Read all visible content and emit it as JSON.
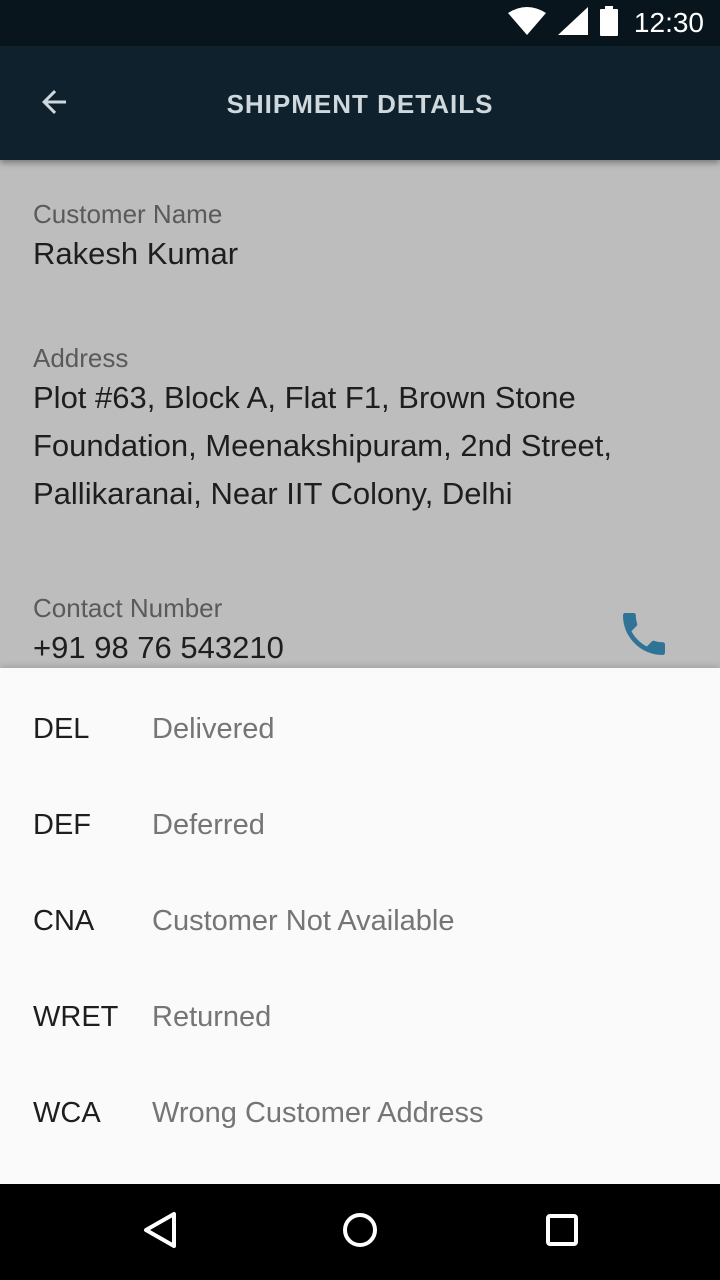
{
  "status_bar": {
    "time": "12:30",
    "icons": [
      "wifi-icon",
      "signal-icon",
      "battery-icon"
    ]
  },
  "app_bar": {
    "title": "SHIPMENT DETAILS",
    "back_icon": "arrow-back-icon"
  },
  "details": {
    "customer_name_label": "Customer Name",
    "customer_name": "Rakesh Kumar",
    "address_label": "Address",
    "address_lines": [
      "Plot #63, Block A, Flat F1, Brown Stone",
      "Foundation, Meenakshipuram, 2nd Street,",
      "Pallikaranai, Near IIT Colony, Delhi"
    ],
    "contact_label": "Contact Number",
    "contact_number": "+91 98 76 543210",
    "phone_icon": "phone-icon",
    "phone_color": "#2f7397"
  },
  "status_options": [
    {
      "code": "DEL",
      "label": "Delivered"
    },
    {
      "code": "DEF",
      "label": "Deferred"
    },
    {
      "code": "CNA",
      "label": "Customer Not Available"
    },
    {
      "code": "WRET",
      "label": "Returned"
    },
    {
      "code": "WCA",
      "label": "Wrong Customer Address"
    }
  ],
  "nav_bar": {
    "icons": [
      "back-triangle-icon",
      "home-circle-icon",
      "recents-square-icon"
    ]
  },
  "colors": {
    "status_bar": "#08151c",
    "app_bar": "#0e212c",
    "scrim": "#bdbdbd",
    "sheet": "#fafafa"
  }
}
